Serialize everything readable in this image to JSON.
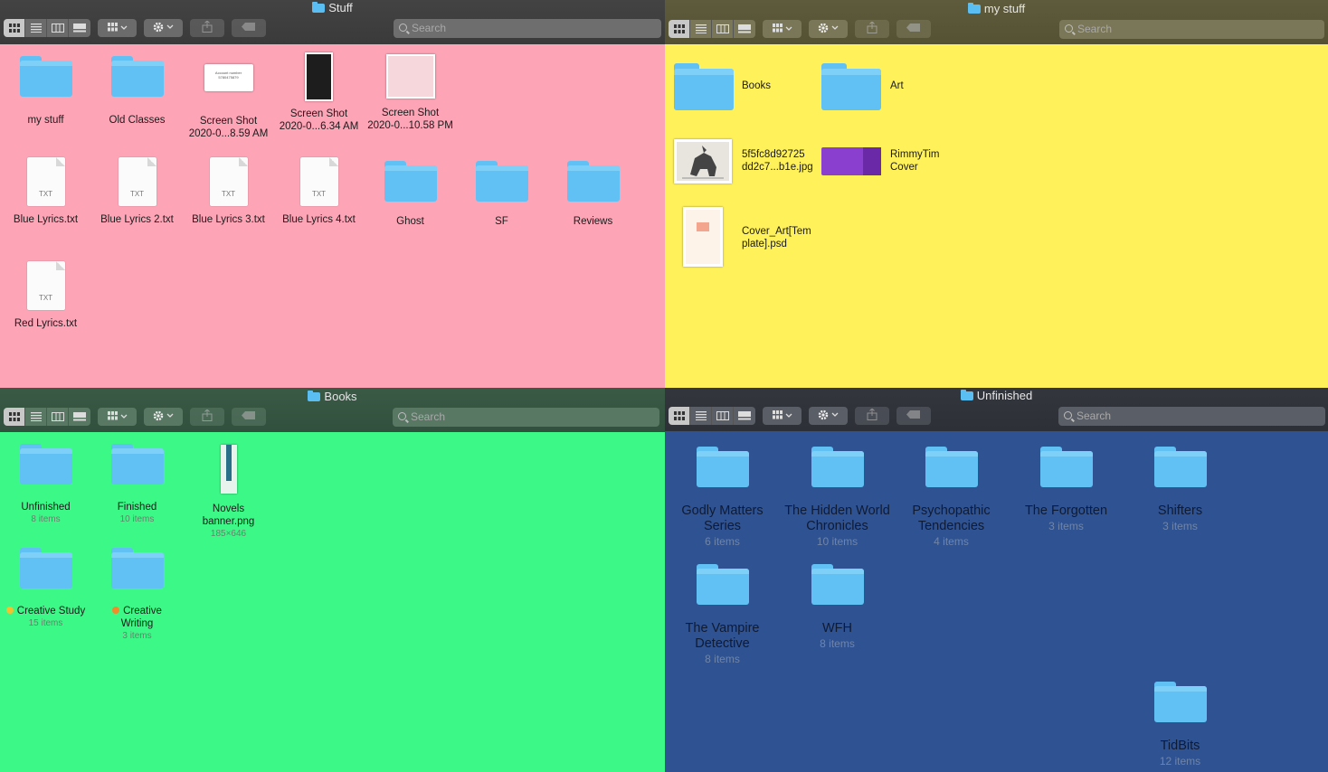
{
  "windows": {
    "stuff": {
      "title": "Stuff",
      "search_placeholder": "Search",
      "items": [
        {
          "label": "my stuff"
        },
        {
          "label": "Old Classes"
        },
        {
          "label": "Screen Shot\n2020-0...8.59 AM",
          "thumb_text": "Account number\n5780475879"
        },
        {
          "label": "Screen Shot\n2020-0...6.34 AM"
        },
        {
          "label": "Screen Shot\n2020-0...10.58 PM"
        },
        {
          "label": "Blue Lyrics.txt",
          "badge": "TXT"
        },
        {
          "label": "Blue Lyrics 2.txt",
          "badge": "TXT"
        },
        {
          "label": "Blue Lyrics 3.txt",
          "badge": "TXT"
        },
        {
          "label": "Blue Lyrics 4.txt",
          "badge": "TXT"
        },
        {
          "label": "Ghost"
        },
        {
          "label": "SF"
        },
        {
          "label": "Reviews"
        },
        {
          "label": "Red Lyrics.txt",
          "badge": "TXT"
        }
      ]
    },
    "mystuff": {
      "title": "my stuff",
      "search_placeholder": "Search",
      "items": [
        {
          "label": "Books"
        },
        {
          "label": "Art"
        },
        {
          "label": "5f5fc8d92725\ndd2c7...b1e.jpg"
        },
        {
          "label": "RimmyTim\nCover"
        },
        {
          "label": "Cover_Art[Tem\nplate].psd"
        }
      ]
    },
    "books": {
      "title": "Books",
      "search_placeholder": "Search",
      "items": [
        {
          "label": "Unfinished",
          "sub": "8 items"
        },
        {
          "label": "Finished",
          "sub": "10 items"
        },
        {
          "label": "Novels\nbanner.png",
          "sub": "185×646"
        },
        {
          "label": "Creative Study",
          "sub": "15 items",
          "tag_color": "#f2c230"
        },
        {
          "label": "Creative\nWriting",
          "sub": "3 items",
          "tag_color": "#f28a2a"
        }
      ]
    },
    "unfinished": {
      "title": "Unfinished",
      "search_placeholder": "Search",
      "items": [
        {
          "label": "Godly Matters\nSeries",
          "sub": "6 items"
        },
        {
          "label": "The Hidden World\nChronicles",
          "sub": "10 items"
        },
        {
          "label": "Psychopathic\nTendencies",
          "sub": "4 items"
        },
        {
          "label": "The Forgotten",
          "sub": "3 items"
        },
        {
          "label": "Shifters",
          "sub": "3 items"
        },
        {
          "label": "The Vampire\nDetective",
          "sub": "8 items"
        },
        {
          "label": "WFH",
          "sub": "8 items"
        },
        {
          "label": "TidBits",
          "sub": "12 items"
        }
      ]
    }
  },
  "icons": [
    "icon-view-icon",
    "list-view-icon",
    "column-view-icon",
    "gallery-view-icon",
    "group-icon",
    "gear-icon",
    "share-icon",
    "tag-icon",
    "search-icon",
    "folder-icon",
    "txt-file-icon"
  ],
  "colors": {
    "stuff_bg": "#fda5b7",
    "mystuff_bg": "#fff15a",
    "books_bg": "#3cf887",
    "unfinished_bg": "#2f5392",
    "folder": "#62c1f4"
  }
}
